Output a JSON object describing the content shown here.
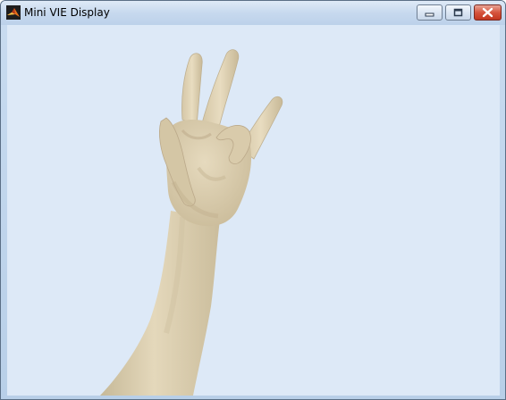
{
  "window": {
    "title": "Mini VIE Display",
    "app_icon": "matlab-logo-icon"
  },
  "title_buttons": {
    "minimize_icon": "minimize-icon",
    "maximize_icon": "maximize-icon",
    "close_icon": "close-icon"
  },
  "display": {
    "background_color": "#dde9f7",
    "skin_color": "#ddd0b2",
    "scene": "3D rendered arm and hand"
  }
}
